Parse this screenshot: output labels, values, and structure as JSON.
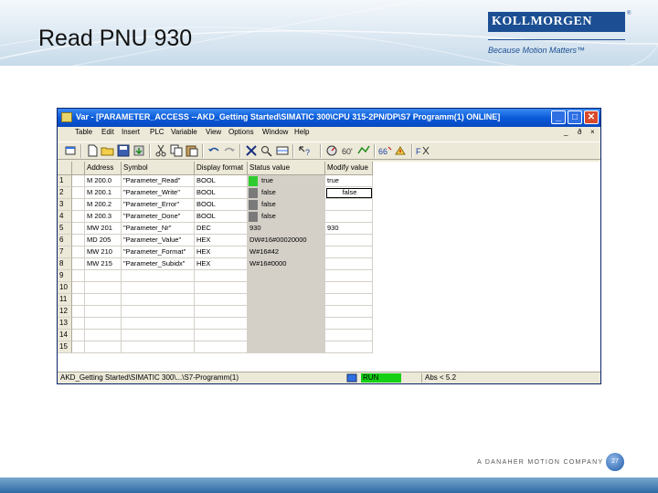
{
  "slide": {
    "title": "Read PNU 930",
    "logo": "KOLLMORGEN",
    "logo_reg": "®",
    "tagline": "Because Motion Matters™",
    "footer": "A DANAHER MOTION COMPANY",
    "page_number": "27"
  },
  "window": {
    "title": "Var  -  [PARAMETER_ACCESS   --AKD_Getting Started\\SIMATIC 300\\CPU 315-2PN/DP\\S7 Programm(1)  ONLINE]",
    "caption_buttons": [
      "_",
      "□",
      "✕"
    ],
    "menu": [
      "Table",
      "Edit",
      "Insert",
      "PLC",
      "Variable",
      "View",
      "Options",
      "Window",
      "Help"
    ],
    "mdi_buttons": [
      "_",
      "ð",
      "×"
    ],
    "columns": [
      "",
      "Address",
      "Symbol",
      "Display format",
      "Status value",
      "Modify value"
    ],
    "rows": [
      {
        "num": "1",
        "address": "M   200.0",
        "symbol": "\"Parameter_Read\"",
        "format": "BOOL",
        "status": "true",
        "status_color": "#2ecc2e",
        "modify": "true"
      },
      {
        "num": "2",
        "address": "M   200.1",
        "symbol": "\"Parameter_Write\"",
        "format": "BOOL",
        "status": "false",
        "status_color": "#7a7a7a",
        "modify": "false"
      },
      {
        "num": "3",
        "address": "M   200.2",
        "symbol": "\"Parameter_Error\"",
        "format": "BOOL",
        "status": "false",
        "status_color": "#7a7a7a",
        "modify": ""
      },
      {
        "num": "4",
        "address": "M   200.3",
        "symbol": "\"Parameter_Done\"",
        "format": "BOOL",
        "status": "false",
        "status_color": "#7a7a7a",
        "modify": ""
      },
      {
        "num": "5",
        "address": "MW  201",
        "symbol": "\"Parameter_Nr\"",
        "format": "DEC",
        "status": "930",
        "status_color": "",
        "modify": "930"
      },
      {
        "num": "6",
        "address": "MD  205",
        "symbol": "\"Parameter_Value\"",
        "format": "HEX",
        "status": "DW#16#00020000",
        "status_color": "",
        "modify": ""
      },
      {
        "num": "7",
        "address": "MW  210",
        "symbol": "\"Parameter_Format\"",
        "format": "HEX",
        "status": "W#16#42",
        "status_color": "",
        "modify": ""
      },
      {
        "num": "8",
        "address": "MW  215",
        "symbol": "\"Parameter_Subidx\"",
        "format": "HEX",
        "status": "W#16#0000",
        "status_color": "",
        "modify": ""
      },
      {
        "num": "9"
      },
      {
        "num": "10"
      },
      {
        "num": "11"
      },
      {
        "num": "12"
      },
      {
        "num": "13"
      },
      {
        "num": "14"
      },
      {
        "num": "15"
      }
    ],
    "status_bar": {
      "path": "AKD_Getting Started\\SIMATIC 300\\...\\S7-Programm(1)",
      "run": "RUN",
      "abs": "Abs < 5.2"
    }
  },
  "colors": {
    "title_bar": "#0a5bd8",
    "run": "#15d015",
    "brand": "#1b4e93"
  }
}
